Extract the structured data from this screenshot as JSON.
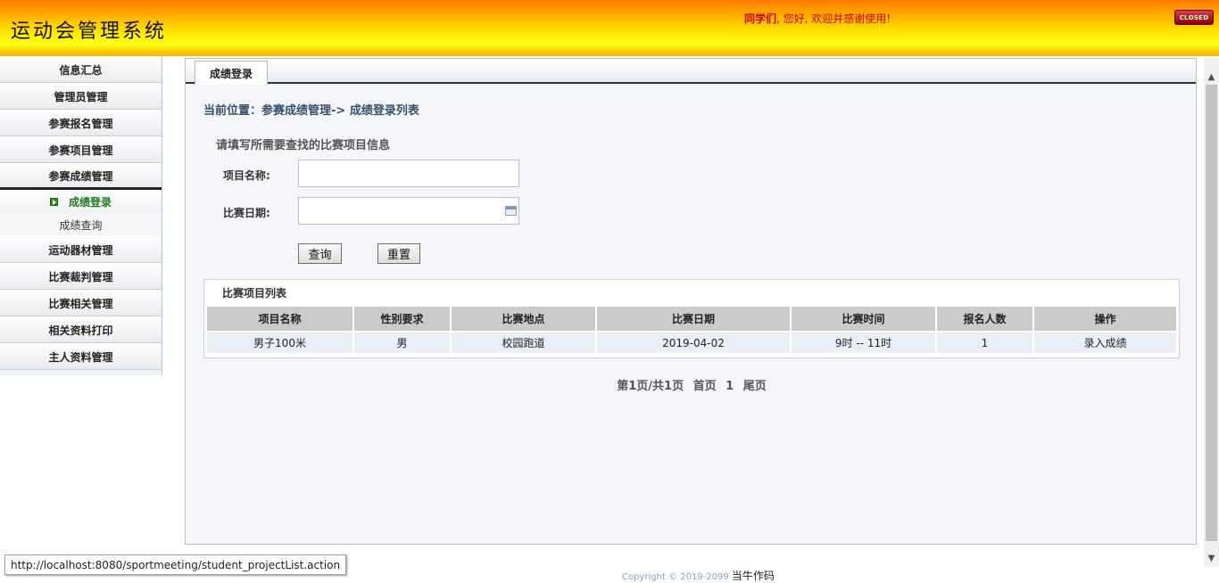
{
  "header": {
    "title": "运动会管理系统",
    "welcome_user": "同学们",
    "welcome_text": ", 您好, 欢迎并感谢使用!",
    "closed_label": "CLOSED"
  },
  "sidebar": {
    "items": [
      {
        "label": "信息汇总"
      },
      {
        "label": "管理员管理"
      },
      {
        "label": "参赛报名管理"
      },
      {
        "label": "参赛项目管理"
      },
      {
        "label": "参赛成绩管理"
      }
    ],
    "sub_items": [
      {
        "label": "成绩登录"
      },
      {
        "label": "成绩查询"
      }
    ],
    "items_after": [
      {
        "label": "运动器材管理"
      },
      {
        "label": "比赛裁判管理"
      },
      {
        "label": "比赛相关管理"
      },
      {
        "label": "相关资料打印"
      },
      {
        "label": "主人资料管理"
      }
    ]
  },
  "main": {
    "tab_label": "成绩登录",
    "breadcrumb": "当前位置：参赛成绩管理-> 成绩登录列表",
    "form_title": "请填写所需要查找的比赛项目信息",
    "fields": {
      "name_label": "项目名称:",
      "name_value": "",
      "date_label": "比赛日期:",
      "date_value": ""
    },
    "buttons": {
      "query": "查询",
      "reset": "重置"
    },
    "list_title": "比赛项目列表",
    "table": {
      "headers": [
        "项目名称",
        "性别要求",
        "比赛地点",
        "比赛日期",
        "比赛时间",
        "报名人数",
        "操作"
      ],
      "rows": [
        [
          "男子100米",
          "男",
          "校园跑道",
          "2019-04-02",
          "9时 -- 11时",
          "1",
          "录入成绩"
        ]
      ]
    },
    "pager": {
      "info": "第1页/共1页",
      "first": "首页",
      "page": "1",
      "last": "尾页"
    }
  },
  "footer": {
    "copyright": "Copyright © 2019-2099",
    "author": "当牛作码"
  },
  "status_url": "http://localhost:8080/sportmeeting/student_projectList.action"
}
